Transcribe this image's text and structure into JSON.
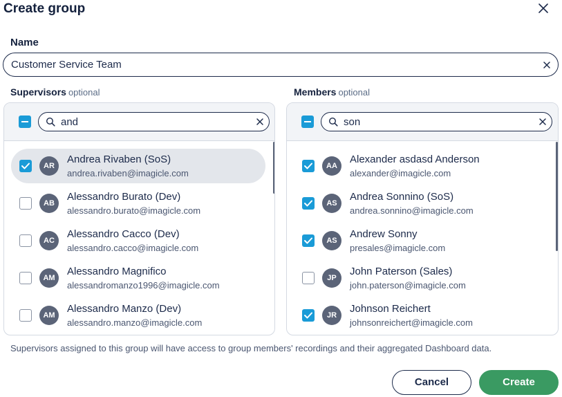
{
  "dialog": {
    "title": "Create group"
  },
  "name_field": {
    "label": "Name",
    "value": "Customer Service Team"
  },
  "supervisors": {
    "label": "Supervisors",
    "optional": "optional",
    "search_value": "and",
    "items": [
      {
        "initials": "AR",
        "name": "Andrea Rivaben (SoS)",
        "email": "andrea.rivaben@imagicle.com",
        "checked": true,
        "highlighted": true
      },
      {
        "initials": "AB",
        "name": "Alessandro Burato (Dev)",
        "email": "alessandro.burato@imagicle.com",
        "checked": false
      },
      {
        "initials": "AC",
        "name": "Alessandro Cacco (Dev)",
        "email": "alessandro.cacco@imagicle.com",
        "checked": false
      },
      {
        "initials": "AM",
        "name": "Alessandro Magnifico",
        "email": "alessandromanzo1996@imagicle.com",
        "checked": false
      },
      {
        "initials": "AM",
        "name": "Alessandro Manzo (Dev)",
        "email": "alessandro.manzo@imagicle.com",
        "checked": false
      }
    ]
  },
  "members": {
    "label": "Members",
    "optional": "optional",
    "search_value": "son",
    "items": [
      {
        "initials": "AA",
        "name": "Alexander asdasd Anderson",
        "email": "alexander@imagicle.com",
        "checked": true
      },
      {
        "initials": "AS",
        "name": "Andrea Sonnino (SoS)",
        "email": "andrea.sonnino@imagicle.com",
        "checked": true
      },
      {
        "initials": "AS",
        "name": "Andrew Sonny",
        "email": "presales@imagicle.com",
        "checked": true
      },
      {
        "initials": "JP",
        "name": "John Paterson (Sales)",
        "email": "john.paterson@imagicle.com",
        "checked": false
      },
      {
        "initials": "JR",
        "name": "Johnson Reichert",
        "email": "johnsonreichert@imagicle.com",
        "checked": true
      }
    ]
  },
  "note": "Supervisors assigned to this group will have access to group members' recordings and their aggregated Dashboard data.",
  "buttons": {
    "cancel": "Cancel",
    "create": "Create"
  },
  "colors": {
    "accent": "#1a9bd7",
    "primary": "#3a9a62",
    "text": "#1c2a4a"
  },
  "icons": {
    "close": "close-icon",
    "search": "search-icon",
    "check": "check-icon"
  }
}
